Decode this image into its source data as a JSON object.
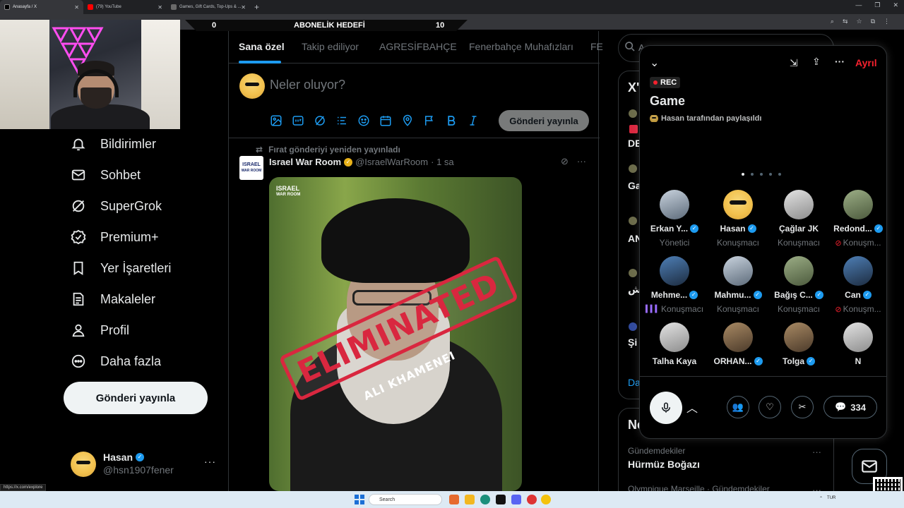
{
  "browser": {
    "tabs": [
      {
        "label": "Anasayfa / X",
        "active": true
      },
      {
        "label": "(79) YouTube",
        "active": false
      },
      {
        "label": "Games, Gift Cards, Top-Ups & ...",
        "active": false
      }
    ],
    "status_url": "https://x.com/explore"
  },
  "stream_hud": {
    "left": "0",
    "title": "ABONELİK HEDEFİ",
    "right": "10"
  },
  "nav": {
    "items": [
      {
        "label": "Bildirimler",
        "icon": "bell-icon"
      },
      {
        "label": "Sohbet",
        "icon": "mail-icon"
      },
      {
        "label": "SuperGrok",
        "icon": "grok-icon"
      },
      {
        "label": "Premium+",
        "icon": "verified-icon"
      },
      {
        "label": "Yer İşaretleri",
        "icon": "bookmark-icon"
      },
      {
        "label": "Makaleler",
        "icon": "article-icon"
      },
      {
        "label": "Profil",
        "icon": "user-icon"
      },
      {
        "label": "Daha fazla",
        "icon": "more-circle-icon"
      }
    ],
    "post_button": "Gönderi yayınla",
    "account": {
      "name": "Hasan",
      "handle": "@hsn1907fener",
      "more": "···"
    }
  },
  "feed": {
    "tabs": [
      "Sana özel",
      "Takip ediliyor",
      "AGRESİFBAHÇE",
      "Fenerbahçe Muhafızları",
      "FE"
    ],
    "composer": {
      "placeholder": "Neler oluyor?",
      "post_button": "Gönderi yayınla"
    },
    "tweet": {
      "retweet_note": "Fırat gönderiyi yeniden yayınladı",
      "author": "Israel War Room",
      "handle": "@IsraelWarRoom",
      "time": "· 1 sa",
      "avatar_text_1": "ISRAEL",
      "avatar_text_2": "WAR ROOM",
      "image_logo_1": "ISRAEL",
      "image_logo_2": "WAR ROOM",
      "stamp": "ELIMINATED",
      "stamp_sub": "ALI KHAMENEI"
    }
  },
  "right": {
    "search_partial": "A",
    "box_title_partial": "X'",
    "row_partials": [
      "DE",
      "Ga",
      "AN",
      "ش",
      "Şi",
      "Da"
    ],
    "news_title_partial": "Ne",
    "trend_1": {
      "context": "Gündemdekiler",
      "title": "Hürmüz Boğazı"
    },
    "trend_2": {
      "context": "Olympique Marseille · Gündemdekiler"
    }
  },
  "space": {
    "leave": "Ayrıl",
    "rec": "REC",
    "title": "Game",
    "shared_by": "Hasan tarafından paylaşıldı",
    "speakers": [
      {
        "name": "Erkan Y...",
        "role": "Yönetici",
        "verified": true,
        "pic": "s",
        "status": ""
      },
      {
        "name": "Hasan",
        "role": "Konuşmacı",
        "verified": true,
        "pic": "y",
        "status": ""
      },
      {
        "name": "Çağlar JK",
        "role": "Konuşmacı",
        "verified": false,
        "pic": "w",
        "status": ""
      },
      {
        "name": "Redond...",
        "role": "Konuşm...",
        "verified": true,
        "pic": "g",
        "status": "muted"
      },
      {
        "name": "Mehme...",
        "role": "Konuşmacı",
        "verified": true,
        "pic": "b",
        "status": "talking"
      },
      {
        "name": "Mahmu...",
        "role": "Konuşmacı",
        "verified": true,
        "pic": "s",
        "status": ""
      },
      {
        "name": "Bağış C...",
        "role": "Konuşmacı",
        "verified": true,
        "pic": "g",
        "status": ""
      },
      {
        "name": "Can",
        "role": "Konuşm...",
        "verified": true,
        "pic": "b",
        "status": "muted"
      },
      {
        "name": "Talha Kaya",
        "role": "",
        "verified": false,
        "pic": "w",
        "status": ""
      },
      {
        "name": "ORHAN...",
        "role": "",
        "verified": true,
        "pic": "r",
        "status": ""
      },
      {
        "name": "Tolga",
        "role": "",
        "verified": true,
        "pic": "r",
        "status": ""
      },
      {
        "name": "N",
        "role": "",
        "verified": false,
        "pic": "w",
        "status": ""
      }
    ],
    "comment_count": "334"
  },
  "taskbar": {
    "search_placeholder": "Search",
    "lang": "TUR"
  },
  "colors": {
    "accent": "#1d9bf0",
    "danger": "#f4212e",
    "background": "#000000"
  }
}
